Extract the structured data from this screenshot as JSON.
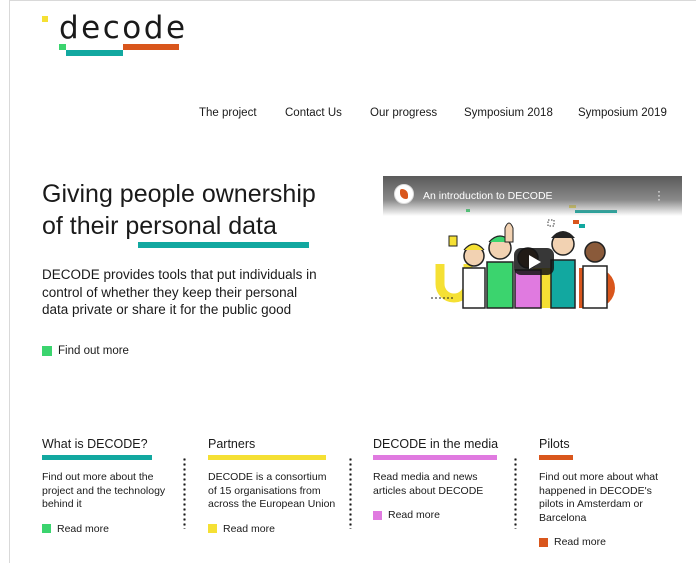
{
  "brand": {
    "name": "decode"
  },
  "colors": {
    "teal": "#12a8a0",
    "orange": "#d9561c",
    "green": "#3bd46e",
    "yellow": "#f5e034",
    "pink": "#e07ae0"
  },
  "nav": {
    "items": [
      {
        "label": "The project"
      },
      {
        "label": "Contact Us"
      },
      {
        "label": "Our progress"
      },
      {
        "label": "Symposium 2018"
      },
      {
        "label": "Symposium 2019"
      }
    ]
  },
  "hero": {
    "title_line1": "Giving people ownership",
    "title_line2_prefix": "of their ",
    "title_line2_emph": "personal data",
    "description": "DECODE provides tools that put individuals in control of whether they keep their personal data private or share it for the public good",
    "cta": "Find out more"
  },
  "video": {
    "title": "An introduction to DECODE",
    "channel_icon": "decode-channel-icon",
    "menu_icon": "kebab-menu-icon",
    "play_icon": "play-button-icon"
  },
  "columns": [
    {
      "title": "What is DECODE?",
      "text": "Find out more about the project and the technology behind it",
      "link": "Read more",
      "color": "#12a8a0",
      "square": "#3bd46e"
    },
    {
      "title": "Partners",
      "text": "DECODE is a consortium of 15 organisations from across the European Union",
      "link": "Read more",
      "color": "#f5e034",
      "square": "#f5e034"
    },
    {
      "title": "DECODE in the media",
      "text": "Read media and news articles about DECODE",
      "link": "Read more",
      "color": "#e07ae0",
      "square": "#e07ae0"
    },
    {
      "title": "Pilots",
      "text": "Find out more about what happened in DECODE's pilots in Amsterdam or Barcelona",
      "link": "Read more",
      "color": "#d9561c",
      "square": "#d9561c"
    }
  ]
}
